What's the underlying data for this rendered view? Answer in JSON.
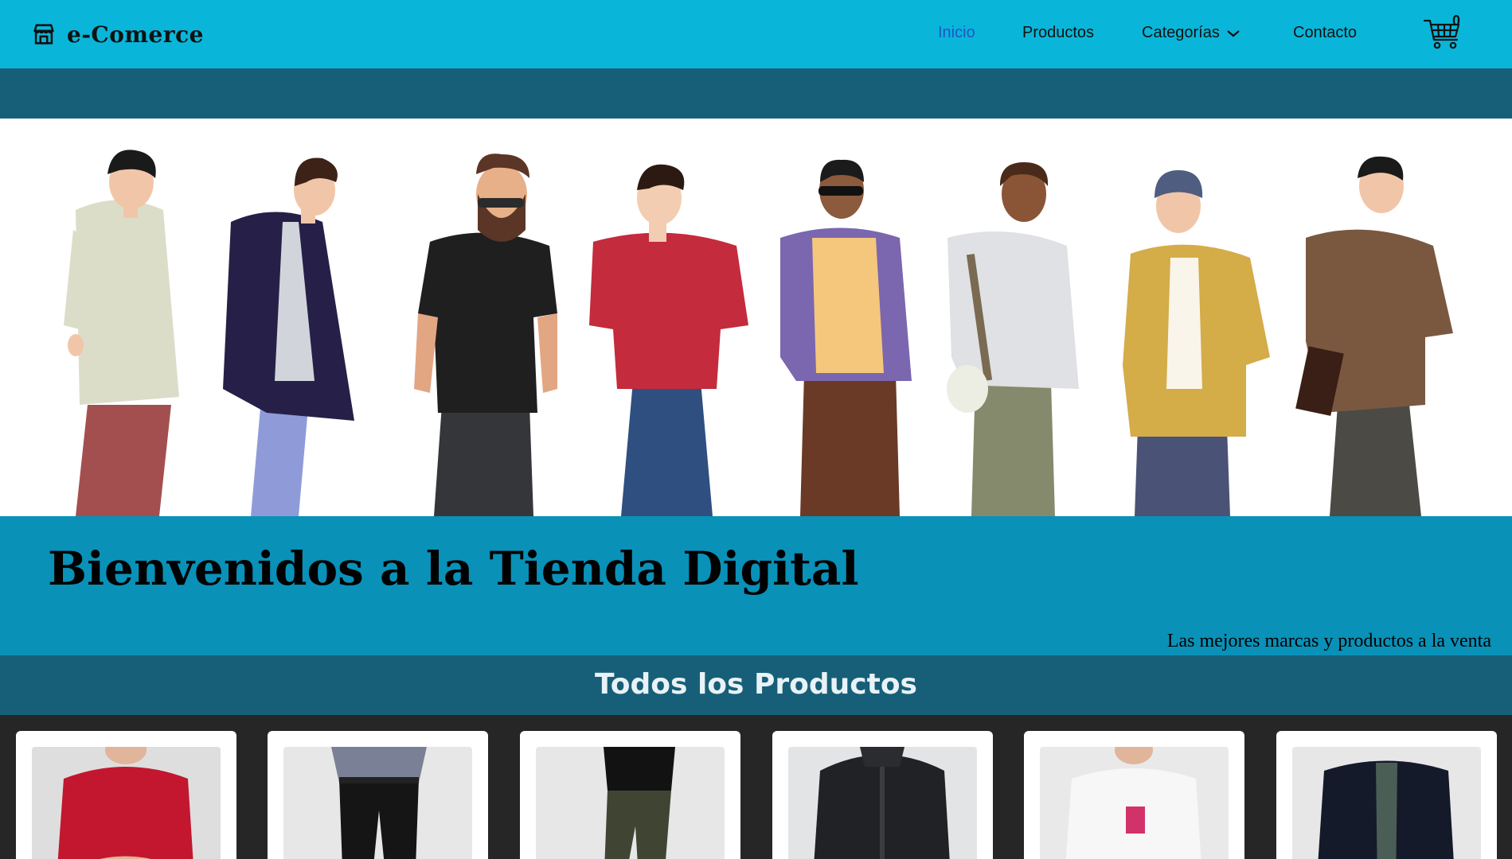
{
  "brand": {
    "name": "e-Comerce",
    "icon": "store-icon"
  },
  "nav": {
    "items": [
      {
        "label": "Inicio",
        "active": true
      },
      {
        "label": "Productos",
        "active": false
      },
      {
        "label": "Categorías",
        "active": false,
        "has_dropdown": true
      },
      {
        "label": "Contacto",
        "active": false
      }
    ],
    "cart_count": "0",
    "cart_icon": "shopping-cart-icon"
  },
  "welcome": {
    "title": "Bienvenidos a la Tienda Digital",
    "subtitle": "Las mejores marcas y productos a la venta"
  },
  "products": {
    "title": "Todos los Productos",
    "items": [
      {
        "image": "red-tshirt"
      },
      {
        "image": "checked-shirt-black-pants"
      },
      {
        "image": "black-shirt-olive-pants"
      },
      {
        "image": "black-zip-jacket"
      },
      {
        "image": "white-tshirt-graphic"
      },
      {
        "image": "navy-jacket-plaid-shirt"
      }
    ]
  },
  "colors": {
    "navbar": "#09b6d9",
    "dark_teal": "#175f78",
    "welcome_bg": "#0991b8",
    "active_link": "#1f56c7",
    "products_bg": "#262626"
  }
}
